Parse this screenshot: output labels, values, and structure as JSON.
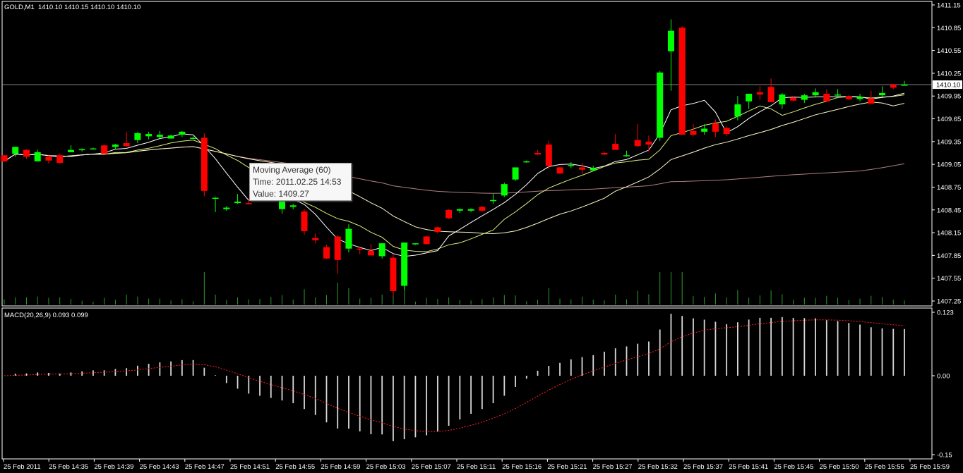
{
  "header": {
    "symbol": "GOLD,M1",
    "ohlc": "1410.10 1410.15 1410.10 1410.10"
  },
  "price_axis": {
    "ticks": [
      "1411.15",
      "1410.85",
      "1410.55",
      "1410.25",
      "1409.95",
      "1409.65",
      "1409.35",
      "1409.05",
      "1408.75",
      "1408.45",
      "1408.15",
      "1407.85",
      "1407.55",
      "1407.25"
    ],
    "current_price_label": "1410.10"
  },
  "macd": {
    "label": "MACD(20,26,9) 0.093 0.099",
    "axis_ticks": [
      "0.123",
      "0.00",
      "-0.15"
    ]
  },
  "time_axis": {
    "labels": [
      "25 Feb 2011",
      "25 Feb 14:35",
      "25 Feb 14:39",
      "25 Feb 14:43",
      "25 Feb 14:47",
      "25 Feb 14:51",
      "25 Feb 14:55",
      "25 Feb 14:59",
      "25 Feb 15:03",
      "25 Feb 15:07",
      "25 Feb 15:11",
      "25 Feb 15:16",
      "25 Feb 15:21",
      "25 Feb 15:27",
      "25 Feb 15:32",
      "25 Feb 15:37",
      "25 Feb 15:41",
      "25 Feb 15:45",
      "25 Feb 15:50",
      "25 Feb 15:55",
      "25 Feb 15:59"
    ]
  },
  "tooltip": {
    "title": "Moving Average (60)",
    "time": "Time: 2011.02.25 14:53",
    "value": "Value: 1409.27"
  },
  "colors": {
    "background": "#000000",
    "bull": "#00ff00",
    "bear": "#ff0000",
    "volume": "#2e9b2e",
    "macd_hist": "#d8d8d8",
    "macd_signal": "#ff2020",
    "ma_fast": "#ffffff",
    "ma_mid": "#d9f07a",
    "ma_slow": "#fff8c8",
    "ma_60": "#b08080",
    "grid_frame": "#ffffff"
  },
  "candles": [
    [
      1409.17,
      1409.17,
      1409.09,
      1409.09
    ],
    [
      1409.19,
      1409.28,
      1409.15,
      1409.28
    ],
    [
      1409.24,
      1409.25,
      1409.12,
      1409.15
    ],
    [
      1409.09,
      1409.24,
      1409.09,
      1409.21
    ],
    [
      1409.15,
      1409.18,
      1409.06,
      1409.1
    ],
    [
      1409.17,
      1409.19,
      1409.06,
      1409.07
    ],
    [
      1409.21,
      1409.3,
      1409.21,
      1409.24
    ],
    [
      1409.24,
      1409.26,
      1409.22,
      1409.25
    ],
    [
      1409.26,
      1409.27,
      1409.25,
      1409.26
    ],
    [
      1409.3,
      1409.31,
      1409.19,
      1409.19
    ],
    [
      1409.28,
      1409.32,
      1409.25,
      1409.31
    ],
    [
      1409.33,
      1409.48,
      1409.28,
      1409.29
    ],
    [
      1409.37,
      1409.48,
      1409.33,
      1409.46
    ],
    [
      1409.42,
      1409.48,
      1409.38,
      1409.45
    ],
    [
      1409.41,
      1409.49,
      1409.39,
      1409.44
    ],
    [
      1409.39,
      1409.44,
      1409.39,
      1409.43
    ],
    [
      1409.44,
      1409.49,
      1409.41,
      1409.48
    ],
    [
      1409.39,
      1409.42,
      1409.39,
      1409.4
    ],
    [
      1409.4,
      1409.46,
      1408.63,
      1408.7
    ],
    [
      1408.61,
      1408.62,
      1408.42,
      1408.61
    ],
    [
      1408.46,
      1408.5,
      1408.44,
      1408.48
    ],
    [
      1408.54,
      1408.66,
      1408.53,
      1408.56
    ],
    [
      1408.54,
      1408.6,
      1408.52,
      1408.53
    ],
    [
      1408.66,
      1408.74,
      1408.65,
      1408.7
    ],
    [
      1408.67,
      1408.73,
      1408.59,
      1408.66
    ],
    [
      1408.46,
      1408.59,
      1408.4,
      1408.57
    ],
    [
      1408.49,
      1408.53,
      1408.46,
      1408.51
    ],
    [
      1408.43,
      1408.46,
      1408.12,
      1408.17
    ],
    [
      1408.08,
      1408.14,
      1408.01,
      1408.05
    ],
    [
      1407.96,
      1407.99,
      1407.8,
      1407.81
    ],
    [
      1408.1,
      1408.12,
      1407.61,
      1407.79
    ],
    [
      1407.94,
      1408.26,
      1407.89,
      1408.2
    ],
    [
      1407.94,
      1407.97,
      1407.87,
      1407.93
    ],
    [
      1407.91,
      1408.0,
      1407.88,
      1407.85
    ],
    [
      1407.84,
      1408.01,
      1407.81,
      1408.01
    ],
    [
      1407.82,
      1407.86,
      1407.31,
      1407.38
    ],
    [
      1407.45,
      1408.02,
      1407.4,
      1408.02
    ],
    [
      1408.0,
      1408.01,
      1407.99,
      1408.01
    ],
    [
      1408.1,
      1408.11,
      1407.99,
      1408.0
    ],
    [
      1408.22,
      1408.23,
      1408.14,
      1408.16
    ],
    [
      1408.45,
      1408.46,
      1408.33,
      1408.34
    ],
    [
      1408.44,
      1408.47,
      1408.41,
      1408.46
    ],
    [
      1408.44,
      1408.47,
      1408.42,
      1408.46
    ],
    [
      1408.49,
      1408.5,
      1408.42,
      1408.44
    ],
    [
      1408.57,
      1408.66,
      1408.53,
      1408.58
    ],
    [
      1408.64,
      1408.81,
      1408.62,
      1408.79
    ],
    [
      1408.85,
      1409.01,
      1408.83,
      1409.01
    ],
    [
      1409.09,
      1409.1,
      1409.07,
      1409.09
    ],
    [
      1409.2,
      1409.24,
      1409.17,
      1409.18
    ],
    [
      1409.31,
      1409.36,
      1408.99,
      1409.03
    ],
    [
      1409.01,
      1409.02,
      1408.92,
      1408.93
    ],
    [
      1409.04,
      1409.08,
      1409.0,
      1409.04
    ],
    [
      1409.01,
      1409.07,
      1408.92,
      1408.98
    ],
    [
      1408.97,
      1409.03,
      1408.96,
      1409.0
    ],
    [
      1409.2,
      1409.22,
      1409.17,
      1409.18
    ],
    [
      1409.32,
      1409.45,
      1409.25,
      1409.24
    ],
    [
      1409.17,
      1409.23,
      1409.15,
      1409.17
    ],
    [
      1409.37,
      1409.58,
      1409.28,
      1409.29
    ],
    [
      1409.35,
      1409.43,
      1409.22,
      1409.31
    ],
    [
      1409.4,
      1410.28,
      1409.36,
      1410.26
    ],
    [
      1410.54,
      1410.96,
      1410.02,
      1410.81
    ],
    [
      1410.85,
      1410.87,
      1409.44,
      1409.44
    ],
    [
      1409.49,
      1409.58,
      1409.42,
      1409.44
    ],
    [
      1409.48,
      1409.58,
      1409.44,
      1409.52
    ],
    [
      1409.59,
      1409.64,
      1409.41,
      1409.48
    ],
    [
      1409.53,
      1409.55,
      1409.42,
      1409.45
    ],
    [
      1409.68,
      1409.95,
      1409.63,
      1409.84
    ],
    [
      1409.88,
      1409.9,
      1409.78,
      1409.98
    ],
    [
      1410.0,
      1410.08,
      1409.9,
      1409.97
    ],
    [
      1410.07,
      1410.18,
      1409.87,
      1409.87
    ],
    [
      1409.84,
      1409.99,
      1409.78,
      1409.97
    ],
    [
      1409.93,
      1409.95,
      1409.88,
      1409.89
    ],
    [
      1409.9,
      1409.98,
      1409.86,
      1409.96
    ],
    [
      1409.96,
      1410.05,
      1409.93,
      1410.0
    ],
    [
      1409.98,
      1410.04,
      1409.87,
      1409.88
    ],
    [
      1409.96,
      1410.04,
      1409.92,
      1409.97
    ],
    [
      1409.95,
      1409.96,
      1409.9,
      1409.91
    ],
    [
      1409.91,
      1409.98,
      1409.88,
      1409.94
    ],
    [
      1409.92,
      1410.02,
      1409.85,
      1409.85
    ],
    [
      1409.96,
      1410.08,
      1409.94,
      1409.99
    ],
    [
      1410.1,
      1410.11,
      1410.04,
      1410.06
    ],
    [
      1410.1,
      1410.15,
      1410.1,
      1410.1
    ]
  ]
}
